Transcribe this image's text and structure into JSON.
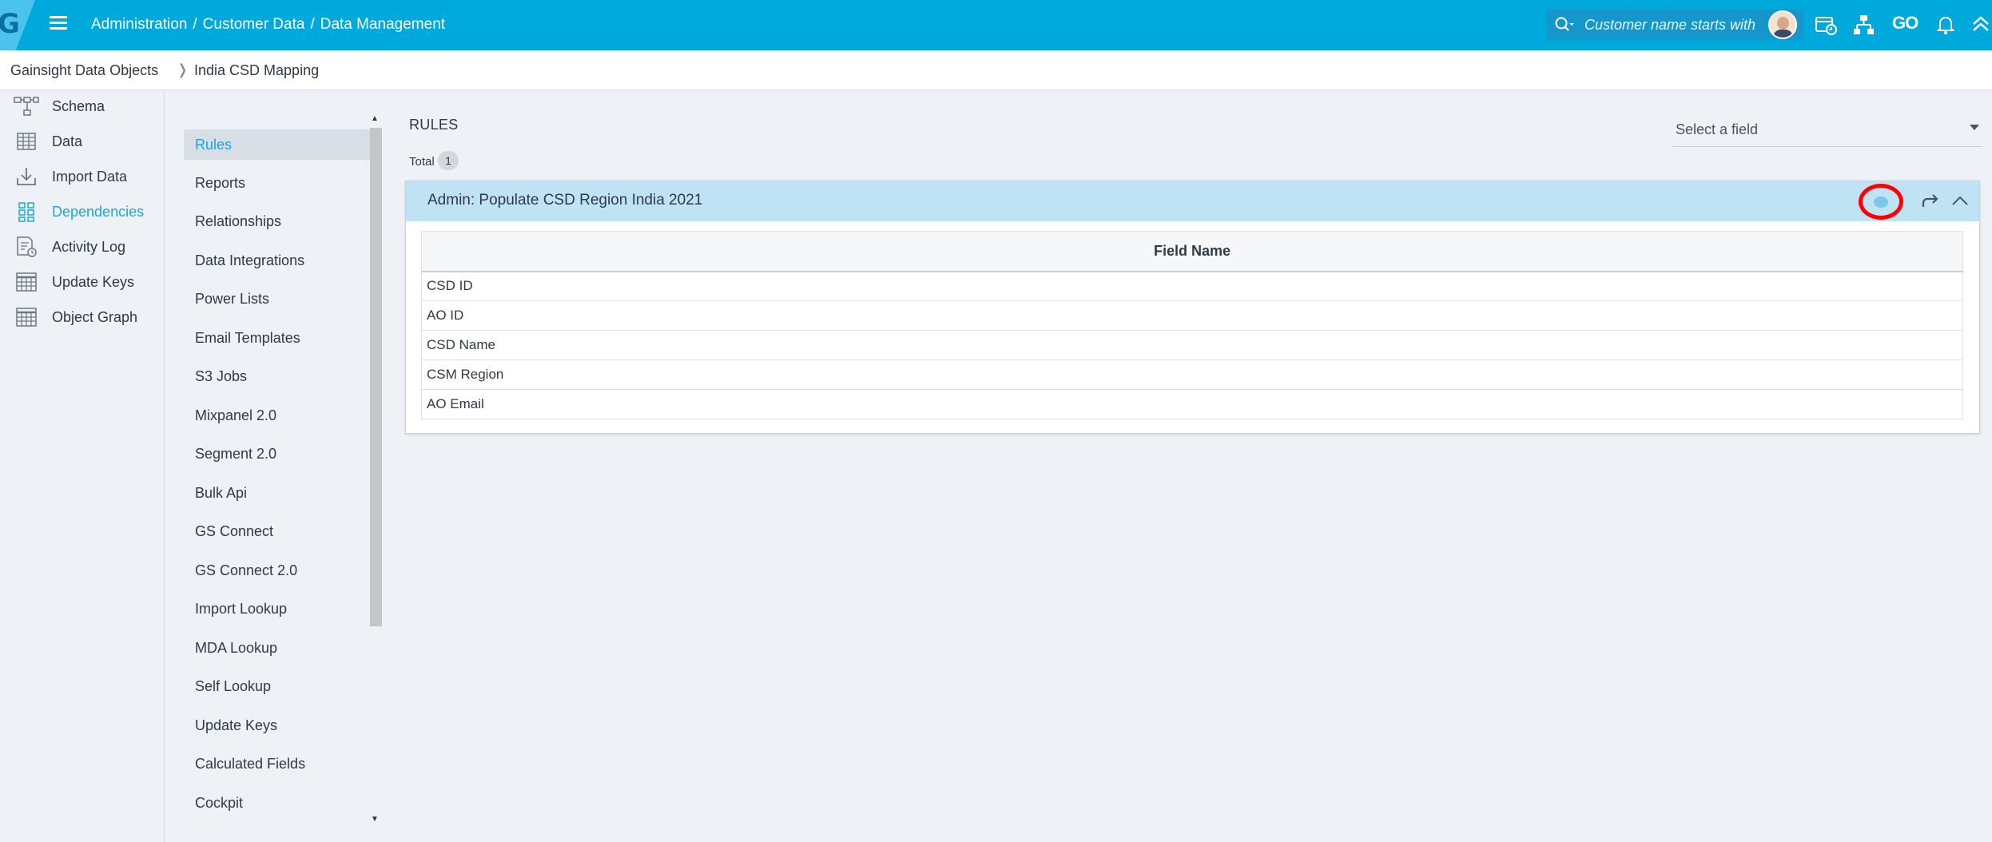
{
  "header": {
    "logo_letter": "G",
    "breadcrumb": [
      "Administration",
      "Customer Data",
      "Data Management"
    ],
    "breadcrumb_separator": "/",
    "search_placeholder": "Customer name starts with",
    "go_label": "GO",
    "accent_color": "#00a9dc"
  },
  "subbar": {
    "parent": "Gainsight Data Objects",
    "current": "India CSD Mapping"
  },
  "leftnav": {
    "items": [
      {
        "label": "Schema",
        "icon": "schema-icon"
      },
      {
        "label": "Data",
        "icon": "data-grid-icon"
      },
      {
        "label": "Import Data",
        "icon": "import-icon"
      },
      {
        "label": "Dependencies",
        "icon": "dependencies-icon",
        "active": true
      },
      {
        "label": "Activity Log",
        "icon": "activity-log-icon"
      },
      {
        "label": "Update Keys",
        "icon": "update-keys-icon"
      },
      {
        "label": "Object Graph",
        "icon": "object-graph-icon"
      }
    ]
  },
  "categories": {
    "items": [
      "Rules",
      "Reports",
      "Relationships",
      "Data Integrations",
      "Power Lists",
      "Email Templates",
      "S3 Jobs",
      "Mixpanel 2.0",
      "Segment 2.0",
      "Bulk Api",
      "GS Connect",
      "GS Connect 2.0",
      "Import Lookup",
      "MDA Lookup",
      "Self Lookup",
      "Update Keys",
      "Calculated Fields",
      "Cockpit"
    ],
    "active_index": 0
  },
  "content": {
    "title": "RULES",
    "total_label": "Total",
    "total_count": "1",
    "field_select_placeholder": "Select a field",
    "rule": {
      "name": "Admin: Populate CSD Region India 2021",
      "table_header": "Field Name",
      "fields": [
        "CSD ID",
        "AO ID",
        "CSD Name",
        "CSM Region",
        "AO Email"
      ]
    }
  }
}
